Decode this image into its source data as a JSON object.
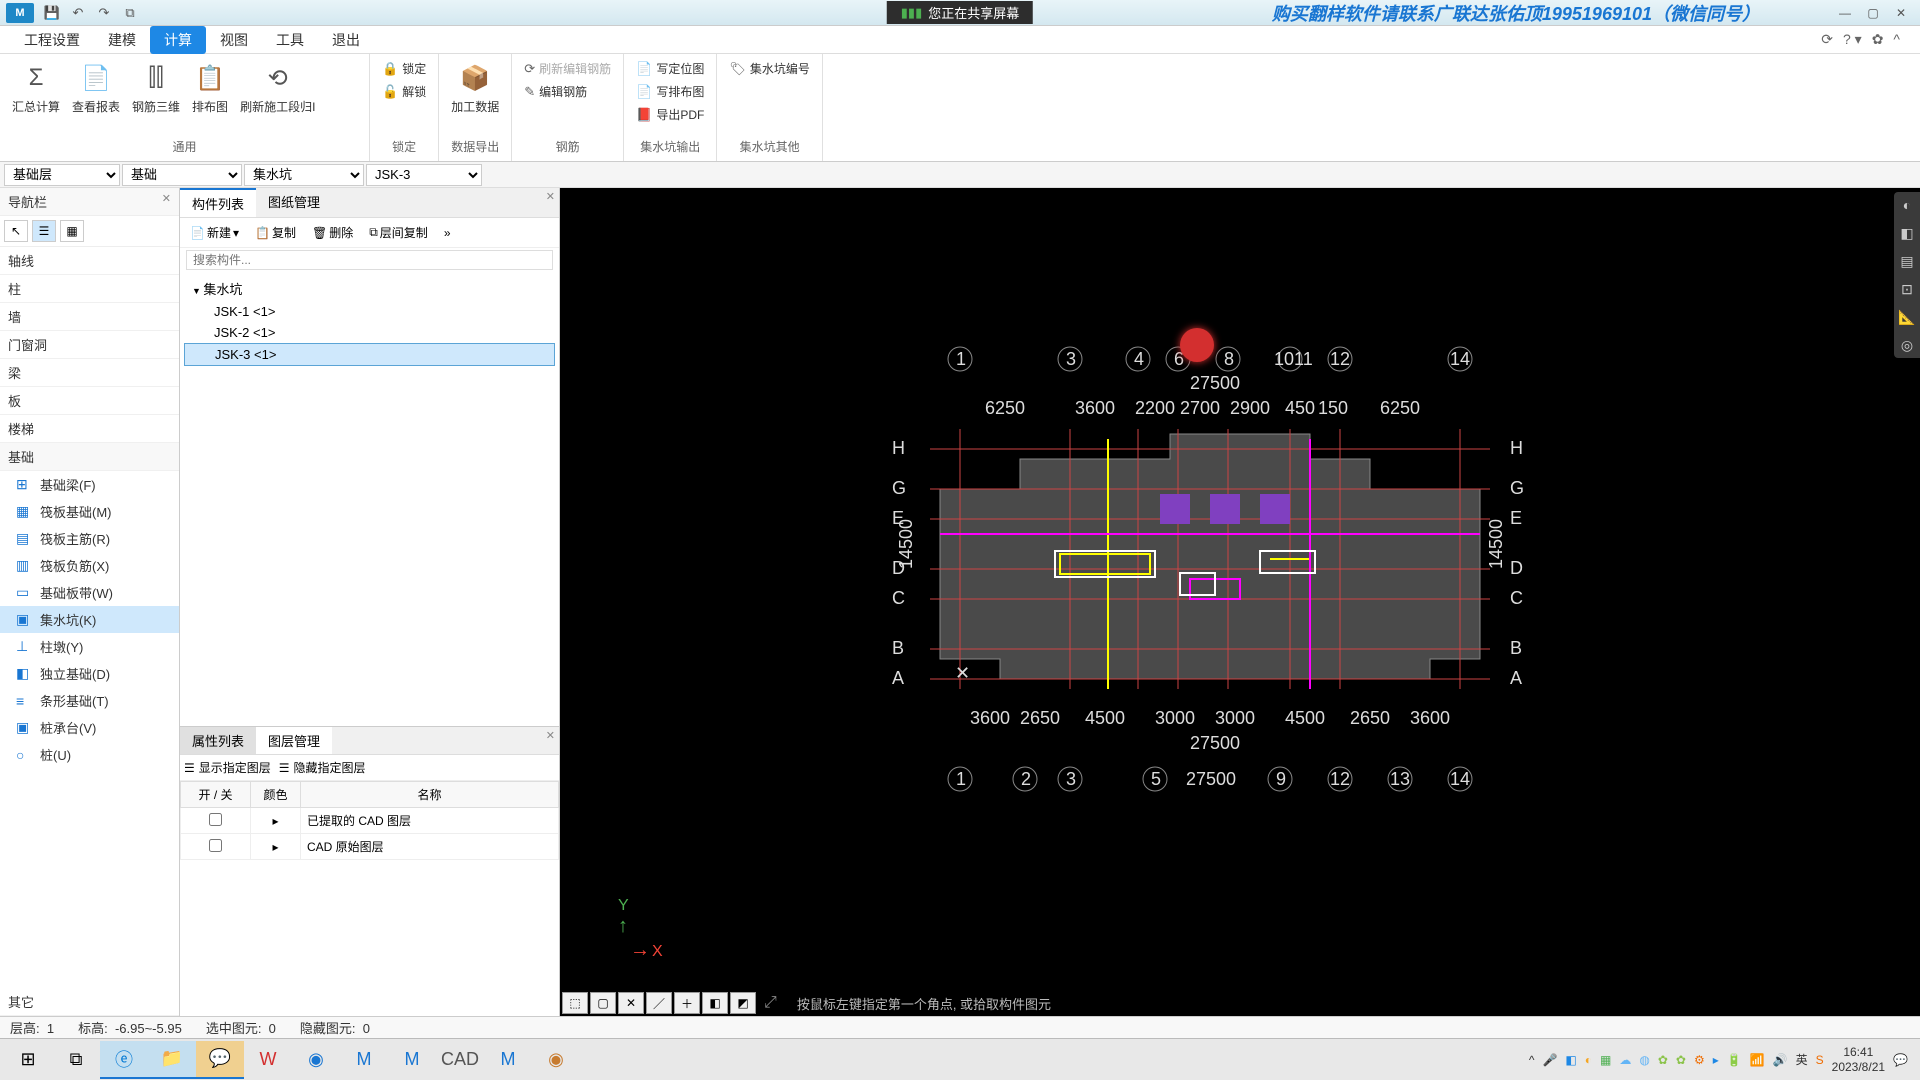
{
  "titlebar": {
    "logo": "M",
    "share": "您正在共享屏幕",
    "ad": "购买翻样软件请联系广联达张佑顶19951969101（微信同号）"
  },
  "menu": {
    "tabs": [
      "工程设置",
      "建模",
      "计算",
      "视图",
      "工具",
      "退出"
    ],
    "active": 2
  },
  "ribbon": {
    "g1": {
      "label": "通用",
      "btns": [
        "汇总计算",
        "查看报表",
        "钢筋三维",
        "排布图",
        "刷新施工段归I"
      ]
    },
    "g2": {
      "label": "锁定",
      "items": [
        "锁定",
        "解锁"
      ]
    },
    "g3": {
      "label": "数据导出",
      "btn": "加工数据"
    },
    "g4": {
      "label": "钢筋",
      "items": [
        "刷新编辑钢筋",
        "编辑钢筋"
      ]
    },
    "g5": {
      "label": "集水坑输出",
      "items": [
        "写定位图",
        "写排布图",
        "导出PDF"
      ]
    },
    "g6": {
      "label": "集水坑其他",
      "items": [
        "集水坑编号"
      ]
    }
  },
  "filters": {
    "a": "基础层",
    "b": "基础",
    "c": "集水坑",
    "d": "JSK-3"
  },
  "nav": {
    "title": "导航栏",
    "sections": [
      "轴线",
      "柱",
      "墙",
      "门窗洞",
      "梁",
      "板",
      "楼梯",
      "基础",
      "其它"
    ],
    "foundation_items": [
      {
        "ico": "⊞",
        "label": "基础梁(F)"
      },
      {
        "ico": "▦",
        "label": "筏板基础(M)"
      },
      {
        "ico": "▤",
        "label": "筏板主筋(R)"
      },
      {
        "ico": "▥",
        "label": "筏板负筋(X)"
      },
      {
        "ico": "▭",
        "label": "基础板带(W)"
      },
      {
        "ico": "▣",
        "label": "集水坑(K)"
      },
      {
        "ico": "⊥",
        "label": "柱墩(Y)"
      },
      {
        "ico": "◧",
        "label": "独立基础(D)"
      },
      {
        "ico": "≡",
        "label": "条形基础(T)"
      },
      {
        "ico": "▣",
        "label": "桩承台(V)"
      },
      {
        "ico": "○",
        "label": "桩(U)"
      }
    ]
  },
  "components": {
    "tabs": [
      "构件列表",
      "图纸管理"
    ],
    "toolbar": {
      "new": "新建",
      "copy": "复制",
      "del": "删除",
      "dup": "层间复制"
    },
    "search_ph": "搜索构件...",
    "root": "集水坑",
    "items": [
      "JSK-1 <1>",
      "JSK-2 <1>",
      "JSK-3 <1>"
    ]
  },
  "lower": {
    "tabs": [
      "属性列表",
      "图层管理"
    ],
    "btns": [
      "显示指定图层",
      "隐藏指定图层"
    ],
    "cols": [
      "开 / 关",
      "颜色",
      "名称"
    ],
    "rows": [
      "已提取的 CAD 图层",
      "CAD 原始图层"
    ]
  },
  "status": {
    "ceng": "层高:",
    "ceng_v": "1",
    "biao": "标高:",
    "biao_v": "-6.95~-5.95",
    "sel": "选中图元:",
    "sel_v": "0",
    "hide": "隐藏图元:",
    "hide_v": "0"
  },
  "vp_hint": "按鼠标左键指定第一个角点, 或拾取构件图元",
  "plan": {
    "top_axes": [
      "1",
      "3",
      "4",
      "6",
      "8",
      "1011",
      "12",
      "14"
    ],
    "top_total": "27500",
    "top_dims": [
      "6250",
      "3600",
      "2200",
      "2700",
      "2900",
      "450",
      "150",
      "6250"
    ],
    "left_axes": [
      "H",
      "G",
      "E",
      "D",
      "C",
      "B",
      "A"
    ],
    "right_axes": [
      "H",
      "G",
      "E",
      "D",
      "C",
      "B",
      "A"
    ],
    "left_total": "14500",
    "bot_total": "27500",
    "bot_axes": [
      "1",
      "2",
      "3",
      "5",
      "27500",
      "9",
      "12",
      "13",
      "14"
    ],
    "bot_dims": [
      "3600",
      "2650",
      "4500",
      "3000",
      "3000",
      "4500",
      "2650",
      "3600"
    ]
  },
  "tray": {
    "time": "16:41",
    "date": "2023/8/21"
  }
}
